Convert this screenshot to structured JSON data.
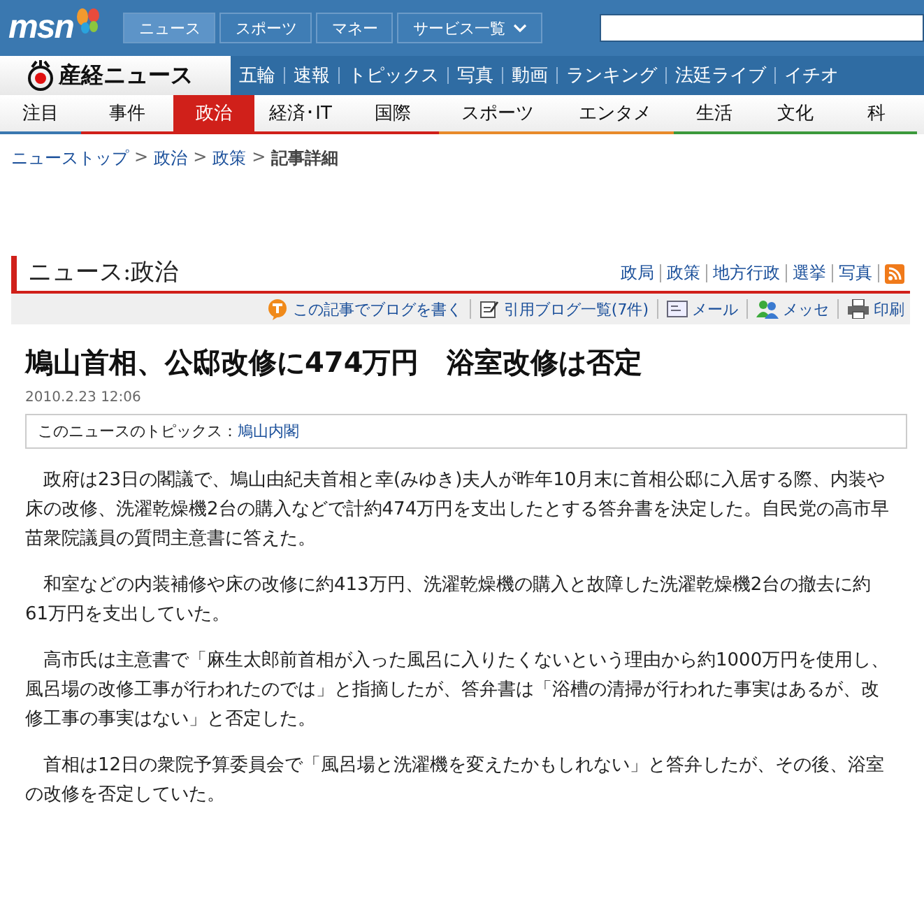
{
  "msn_bar": {
    "logo": "msn",
    "tabs": [
      {
        "label": "ニュース",
        "selected": true,
        "kind": "plain"
      },
      {
        "label": "スポーツ",
        "selected": false,
        "kind": "plain"
      },
      {
        "label": "マネー",
        "selected": false,
        "kind": "plain"
      },
      {
        "label": "サービス一覧",
        "selected": false,
        "kind": "dropdown"
      }
    ]
  },
  "site_nav": {
    "logo": "産経ニュース",
    "items": [
      "五輪",
      "速報",
      "トピックス",
      "写真",
      "動画",
      "ランキング",
      "法廷ライブ",
      "イチオ"
    ]
  },
  "category_nav": [
    {
      "label": "注目",
      "selected": false,
      "color": "#3a78b0"
    },
    {
      "label": "事件",
      "selected": false,
      "color": "#d0201a"
    },
    {
      "label": "政治",
      "selected": true,
      "color": "#d0201a"
    },
    {
      "label": "経済･IT",
      "selected": false,
      "color": "#d0201a"
    },
    {
      "label": "国際",
      "selected": false,
      "color": "#d0201a"
    },
    {
      "label": "スポーツ",
      "selected": false,
      "color": "#e88a2a"
    },
    {
      "label": "エンタメ",
      "selected": false,
      "color": "#e88a2a"
    },
    {
      "label": "生活",
      "selected": false,
      "color": "#3c9a3c"
    },
    {
      "label": "文化",
      "selected": false,
      "color": "#3c9a3c"
    },
    {
      "label": "科",
      "selected": false,
      "color": "#3c9a3c"
    }
  ],
  "breadcrumb": {
    "links": [
      "ニューストップ",
      "政治",
      "政策"
    ],
    "separator": ">",
    "current": "記事詳細"
  },
  "section": {
    "title": "ニュース:政治",
    "links": [
      "政局",
      "政策",
      "地方行政",
      "選挙",
      "写真"
    ]
  },
  "tools": [
    {
      "label": "この記事でブログを書く",
      "kind": "blog"
    },
    {
      "label": "引用ブログ一覧(7件)",
      "kind": "list"
    },
    {
      "label": "メール",
      "kind": "mail"
    },
    {
      "label": "メッセ",
      "kind": "messenger"
    },
    {
      "label": "印刷",
      "kind": "print"
    }
  ],
  "article": {
    "headline": "鳩山首相、公邸改修に474万円　浴室改修は否定",
    "date": "2010.2.23 12:06",
    "topics_label": "このニュースのトピックス：",
    "topics_link": "鳩山内閣",
    "paragraphs": [
      "政府は23日の閣議で、鳩山由紀夫首相と幸(みゆき)夫人が昨年10月末に首相公邸に入居する際、内装や床の改修、洗濯乾燥機2台の購入などで計約474万円を支出したとする答弁書を決定した。自民党の高市早苗衆院議員の質問主意書に答えた。",
      "和室などの内装補修や床の改修に約413万円、洗濯乾燥機の購入と故障した洗濯乾燥機2台の撤去に約61万円を支出していた。",
      "高市氏は主意書で「麻生太郎前首相が入った風呂に入りたくないという理由から約1000万円を使用し、風呂場の改修工事が行われたのでは」と指摘したが、答弁書は「浴槽の清掃が行われた事実はあるが、改修工事の事実はない」と否定した。",
      "首相は12日の衆院予算委員会で「風呂場と洗濯機を変えたかもしれない」と答弁したが、その後、浴室の改修を否定していた。"
    ]
  }
}
